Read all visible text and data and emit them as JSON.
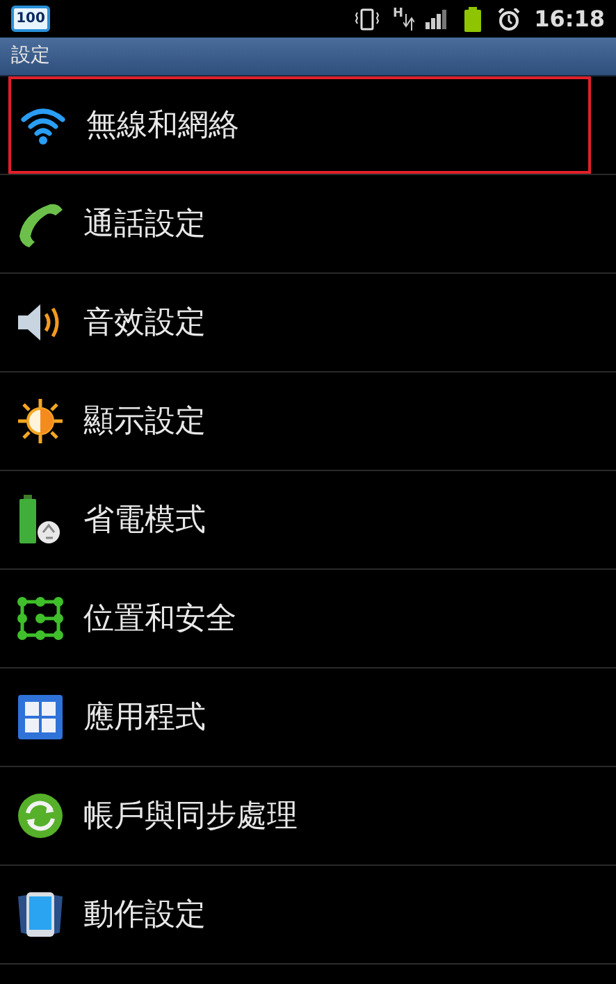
{
  "status_bar": {
    "battery_level_text": "100",
    "network_type": "H",
    "time": "16:18"
  },
  "title_bar": {
    "title": "設定"
  },
  "items": [
    {
      "label": "無線和網絡",
      "selected": true
    },
    {
      "label": "通話設定",
      "selected": false
    },
    {
      "label": "音效設定",
      "selected": false
    },
    {
      "label": "顯示設定",
      "selected": false
    },
    {
      "label": "省電模式",
      "selected": false
    },
    {
      "label": "位置和安全",
      "selected": false
    },
    {
      "label": "應用程式",
      "selected": false
    },
    {
      "label": "帳戶與同步處理",
      "selected": false
    },
    {
      "label": "動作設定",
      "selected": false
    }
  ]
}
